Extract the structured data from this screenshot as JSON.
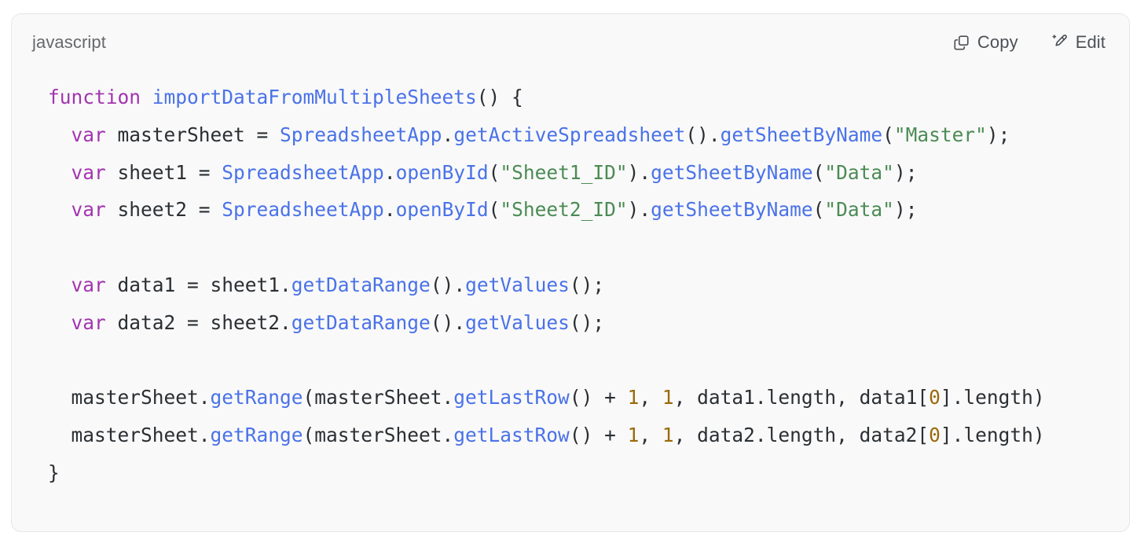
{
  "card": {
    "language_label": "javascript",
    "background_color": "#f9f9f9",
    "border_color": "#e6e6e6"
  },
  "actions": {
    "copy": {
      "label": "Copy",
      "icon": "copy-icon"
    },
    "edit": {
      "label": "Edit",
      "icon": "magic-pencil-icon"
    }
  },
  "syntax_colors": {
    "keyword": "#a334b0",
    "function": "#4a72e8",
    "string": "#4b8b54",
    "number": "#9a6a0a",
    "plain": "#2b2f33"
  },
  "code": {
    "language": "javascript",
    "note": "long lines are visually clipped at the right edge of the card",
    "lines": [
      {
        "index": 1,
        "text": "function importDataFromMultipleSheets() {",
        "tokens": [
          {
            "t": "function",
            "c": "keyword"
          },
          {
            "t": " ",
            "c": "plain"
          },
          {
            "t": "importDataFromMultipleSheets",
            "c": "function"
          },
          {
            "t": "() {",
            "c": "plain"
          }
        ]
      },
      {
        "index": 2,
        "text": "  var masterSheet = SpreadsheetApp.getActiveSpreadsheet().getSheetByName(\"Master\");",
        "tokens": [
          {
            "t": "  ",
            "c": "plain"
          },
          {
            "t": "var",
            "c": "keyword"
          },
          {
            "t": " masterSheet = ",
            "c": "plain"
          },
          {
            "t": "SpreadsheetApp",
            "c": "function"
          },
          {
            "t": ".",
            "c": "plain"
          },
          {
            "t": "getActiveSpreadsheet",
            "c": "function"
          },
          {
            "t": "().",
            "c": "plain"
          },
          {
            "t": "getSheetByName",
            "c": "function"
          },
          {
            "t": "(",
            "c": "plain"
          },
          {
            "t": "\"Master\"",
            "c": "string"
          },
          {
            "t": ");",
            "c": "plain"
          }
        ]
      },
      {
        "index": 3,
        "text": "  var sheet1 = SpreadsheetApp.openById(\"Sheet1_ID\").getSheetByName(\"Data\");",
        "tokens": [
          {
            "t": "  ",
            "c": "plain"
          },
          {
            "t": "var",
            "c": "keyword"
          },
          {
            "t": " sheet1 = ",
            "c": "plain"
          },
          {
            "t": "SpreadsheetApp",
            "c": "function"
          },
          {
            "t": ".",
            "c": "plain"
          },
          {
            "t": "openById",
            "c": "function"
          },
          {
            "t": "(",
            "c": "plain"
          },
          {
            "t": "\"Sheet1_ID\"",
            "c": "string"
          },
          {
            "t": ").",
            "c": "plain"
          },
          {
            "t": "getSheetByName",
            "c": "function"
          },
          {
            "t": "(",
            "c": "plain"
          },
          {
            "t": "\"Data\"",
            "c": "string"
          },
          {
            "t": ");",
            "c": "plain"
          }
        ]
      },
      {
        "index": 4,
        "text": "  var sheet2 = SpreadsheetApp.openById(\"Sheet2_ID\").getSheetByName(\"Data\");",
        "tokens": [
          {
            "t": "  ",
            "c": "plain"
          },
          {
            "t": "var",
            "c": "keyword"
          },
          {
            "t": " sheet2 = ",
            "c": "plain"
          },
          {
            "t": "SpreadsheetApp",
            "c": "function"
          },
          {
            "t": ".",
            "c": "plain"
          },
          {
            "t": "openById",
            "c": "function"
          },
          {
            "t": "(",
            "c": "plain"
          },
          {
            "t": "\"Sheet2_ID\"",
            "c": "string"
          },
          {
            "t": ").",
            "c": "plain"
          },
          {
            "t": "getSheetByName",
            "c": "function"
          },
          {
            "t": "(",
            "c": "plain"
          },
          {
            "t": "\"Data\"",
            "c": "string"
          },
          {
            "t": ");",
            "c": "plain"
          }
        ]
      },
      {
        "index": 5,
        "text": "",
        "tokens": []
      },
      {
        "index": 6,
        "text": "  var data1 = sheet1.getDataRange().getValues();",
        "tokens": [
          {
            "t": "  ",
            "c": "plain"
          },
          {
            "t": "var",
            "c": "keyword"
          },
          {
            "t": " data1 = sheet1.",
            "c": "plain"
          },
          {
            "t": "getDataRange",
            "c": "function"
          },
          {
            "t": "().",
            "c": "plain"
          },
          {
            "t": "getValues",
            "c": "function"
          },
          {
            "t": "();",
            "c": "plain"
          }
        ]
      },
      {
        "index": 7,
        "text": "  var data2 = sheet2.getDataRange().getValues();",
        "tokens": [
          {
            "t": "  ",
            "c": "plain"
          },
          {
            "t": "var",
            "c": "keyword"
          },
          {
            "t": " data2 = sheet2.",
            "c": "plain"
          },
          {
            "t": "getDataRange",
            "c": "function"
          },
          {
            "t": "().",
            "c": "plain"
          },
          {
            "t": "getValues",
            "c": "function"
          },
          {
            "t": "();",
            "c": "plain"
          }
        ]
      },
      {
        "index": 8,
        "text": "",
        "tokens": []
      },
      {
        "index": 9,
        "text": "  masterSheet.getRange(masterSheet.getLastRow() + 1, 1, data1.length, data1[0].length)",
        "tokens": [
          {
            "t": "  masterSheet.",
            "c": "plain"
          },
          {
            "t": "getRange",
            "c": "function"
          },
          {
            "t": "(masterSheet.",
            "c": "plain"
          },
          {
            "t": "getLastRow",
            "c": "function"
          },
          {
            "t": "() + ",
            "c": "plain"
          },
          {
            "t": "1",
            "c": "number"
          },
          {
            "t": ", ",
            "c": "plain"
          },
          {
            "t": "1",
            "c": "number"
          },
          {
            "t": ", data1.length, data1[",
            "c": "plain"
          },
          {
            "t": "0",
            "c": "number"
          },
          {
            "t": "].length)",
            "c": "plain"
          }
        ]
      },
      {
        "index": 10,
        "text": "  masterSheet.getRange(masterSheet.getLastRow() + 1, 1, data2.length, data2[0].length)",
        "tokens": [
          {
            "t": "  masterSheet.",
            "c": "plain"
          },
          {
            "t": "getRange",
            "c": "function"
          },
          {
            "t": "(masterSheet.",
            "c": "plain"
          },
          {
            "t": "getLastRow",
            "c": "function"
          },
          {
            "t": "() + ",
            "c": "plain"
          },
          {
            "t": "1",
            "c": "number"
          },
          {
            "t": ", ",
            "c": "plain"
          },
          {
            "t": "1",
            "c": "number"
          },
          {
            "t": ", data2.length, data2[",
            "c": "plain"
          },
          {
            "t": "0",
            "c": "number"
          },
          {
            "t": "].length)",
            "c": "plain"
          }
        ]
      },
      {
        "index": 11,
        "text": "}",
        "tokens": [
          {
            "t": "}",
            "c": "plain"
          }
        ]
      }
    ]
  }
}
